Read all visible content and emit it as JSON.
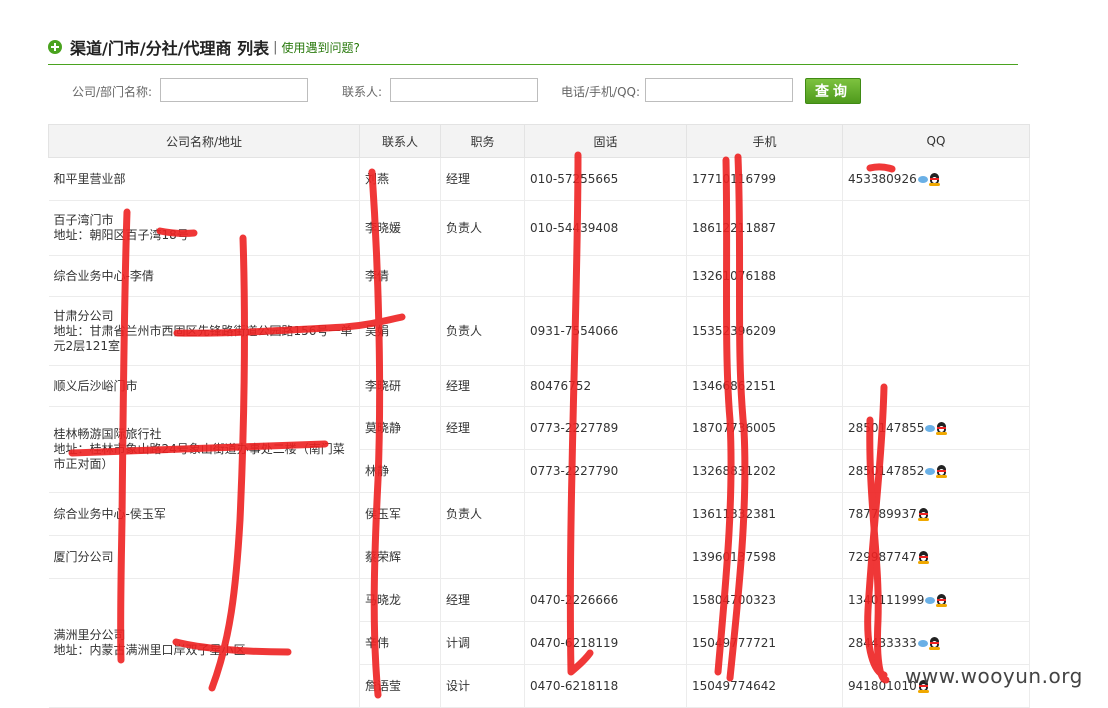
{
  "header": {
    "title": "渠道/门市/分社/代理商 列表",
    "separator": "|",
    "help_link": "使用遇到问题?"
  },
  "search": {
    "company_label": "公司/部门名称:",
    "contact_label": "联系人:",
    "phone_label": "电话/手机/QQ:",
    "company_value": "",
    "contact_value": "",
    "phone_value": "",
    "query_button": "查询"
  },
  "table": {
    "headers": [
      "公司名称/地址",
      "联系人",
      "职务",
      "固话",
      "手机",
      "QQ"
    ],
    "rows": [
      {
        "company": "和平里营业部",
        "contact": "刘燕",
        "title": "经理",
        "landline": "010-57255665",
        "mobile": "17710116799",
        "qq": "453380926"
      },
      {
        "company": "百子湾门市",
        "address": "地址：朝阳区百子湾18号",
        "contact": "李晓媛",
        "title": "负责人",
        "landline": "010-54439408",
        "mobile": "18612211887",
        "qq": ""
      },
      {
        "company": "综合业务中心-李倩",
        "contact": "李倩",
        "title": "",
        "landline": "",
        "mobile": "13261076188",
        "qq": ""
      },
      {
        "company": "甘肃分公司",
        "address": "地址：甘肃省兰州市西固区先锋路街道公园路156号一单元2层121室",
        "contact": "吴娟",
        "title": "负责人",
        "landline": "0931-7554066",
        "mobile": "15352396209",
        "qq": ""
      },
      {
        "company": "顺义后沙峪门市",
        "contact": "李晓研",
        "title": "经理",
        "landline": "80476752",
        "mobile": "13466862151",
        "qq": ""
      },
      {
        "company": "桂林畅游国际旅行社",
        "address": "地址：桂林市象山路24号象山街道办事处二楼（南门菜市正对面）",
        "contacts": [
          {
            "contact": "莫晓静",
            "title": "经理",
            "landline": "0773-2227789",
            "mobile": "18707736005",
            "qq": "2850147855"
          },
          {
            "contact": "林静",
            "title": "",
            "landline": "0773-2227790",
            "mobile": "13268831202",
            "qq": "2850147852"
          }
        ]
      },
      {
        "company": "综合业务中心-侯玉军",
        "contact": "侯玉军",
        "title": "负责人",
        "landline": "",
        "mobile": "13611332381",
        "qq": "787789937"
      },
      {
        "company": "厦门分公司",
        "contact": "蔡荣辉",
        "title": "",
        "landline": "",
        "mobile": "13960137598",
        "qq": "729987747"
      },
      {
        "company": "满洲里分公司",
        "address": "地址：内蒙古满洲里口岸双子星小区",
        "contacts": [
          {
            "contact": "马晓龙",
            "title": "经理",
            "landline": "0470-2226666",
            "mobile": "15804700323",
            "qq": "1340111999"
          },
          {
            "contact": "辛伟",
            "title": "计调",
            "landline": "0470-6218119",
            "mobile": "15049777721",
            "qq": "284433333"
          },
          {
            "contact": "詹语莹",
            "title": "设计",
            "landline": "0470-6218118",
            "mobile": "15049774642",
            "qq": "941801010"
          }
        ]
      }
    ]
  },
  "watermark": "www.wooyun.org",
  "colors": {
    "accent_green": "#4aa31f",
    "redaction_red": "#ee2222",
    "header_bg": "#f3f3f3"
  }
}
